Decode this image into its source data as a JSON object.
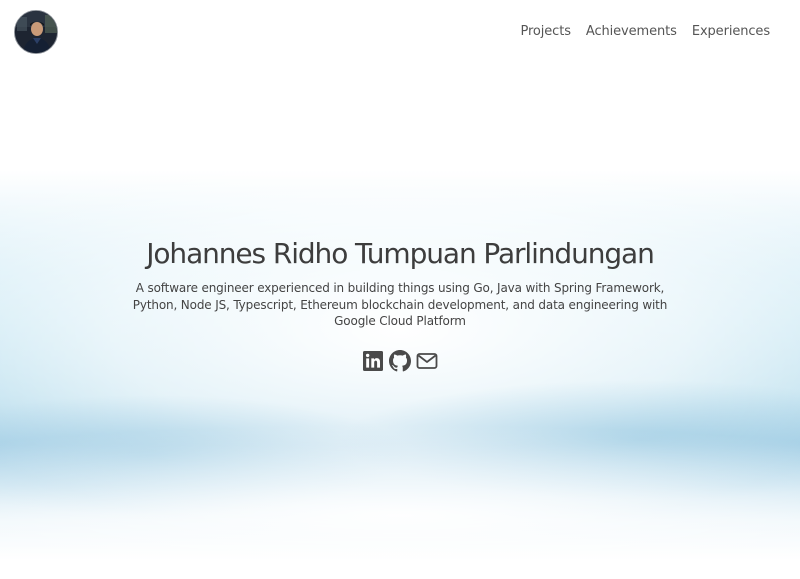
{
  "header": {
    "avatar_alt": "Johannes Ridho Tumpuan Parlindungan",
    "nav": [
      {
        "label": "Projects"
      },
      {
        "label": "Achievements"
      },
      {
        "label": "Experiences"
      }
    ]
  },
  "hero": {
    "name": "Johannes Ridho Tumpuan Parlindungan",
    "description": "A software engineer experienced in building things using Go, Java with Spring Framework, Python, Node JS, Typescript, Ethereum blockchain development, and data engineering with Google Cloud Platform",
    "socials": [
      {
        "icon": "linkedin-icon"
      },
      {
        "icon": "github-icon"
      },
      {
        "icon": "mail-icon"
      }
    ]
  },
  "colors": {
    "text": "#3d3d3d",
    "nav_text": "#555555",
    "icon": "#4a4a4a",
    "sky_blue": "#acd3e8"
  }
}
